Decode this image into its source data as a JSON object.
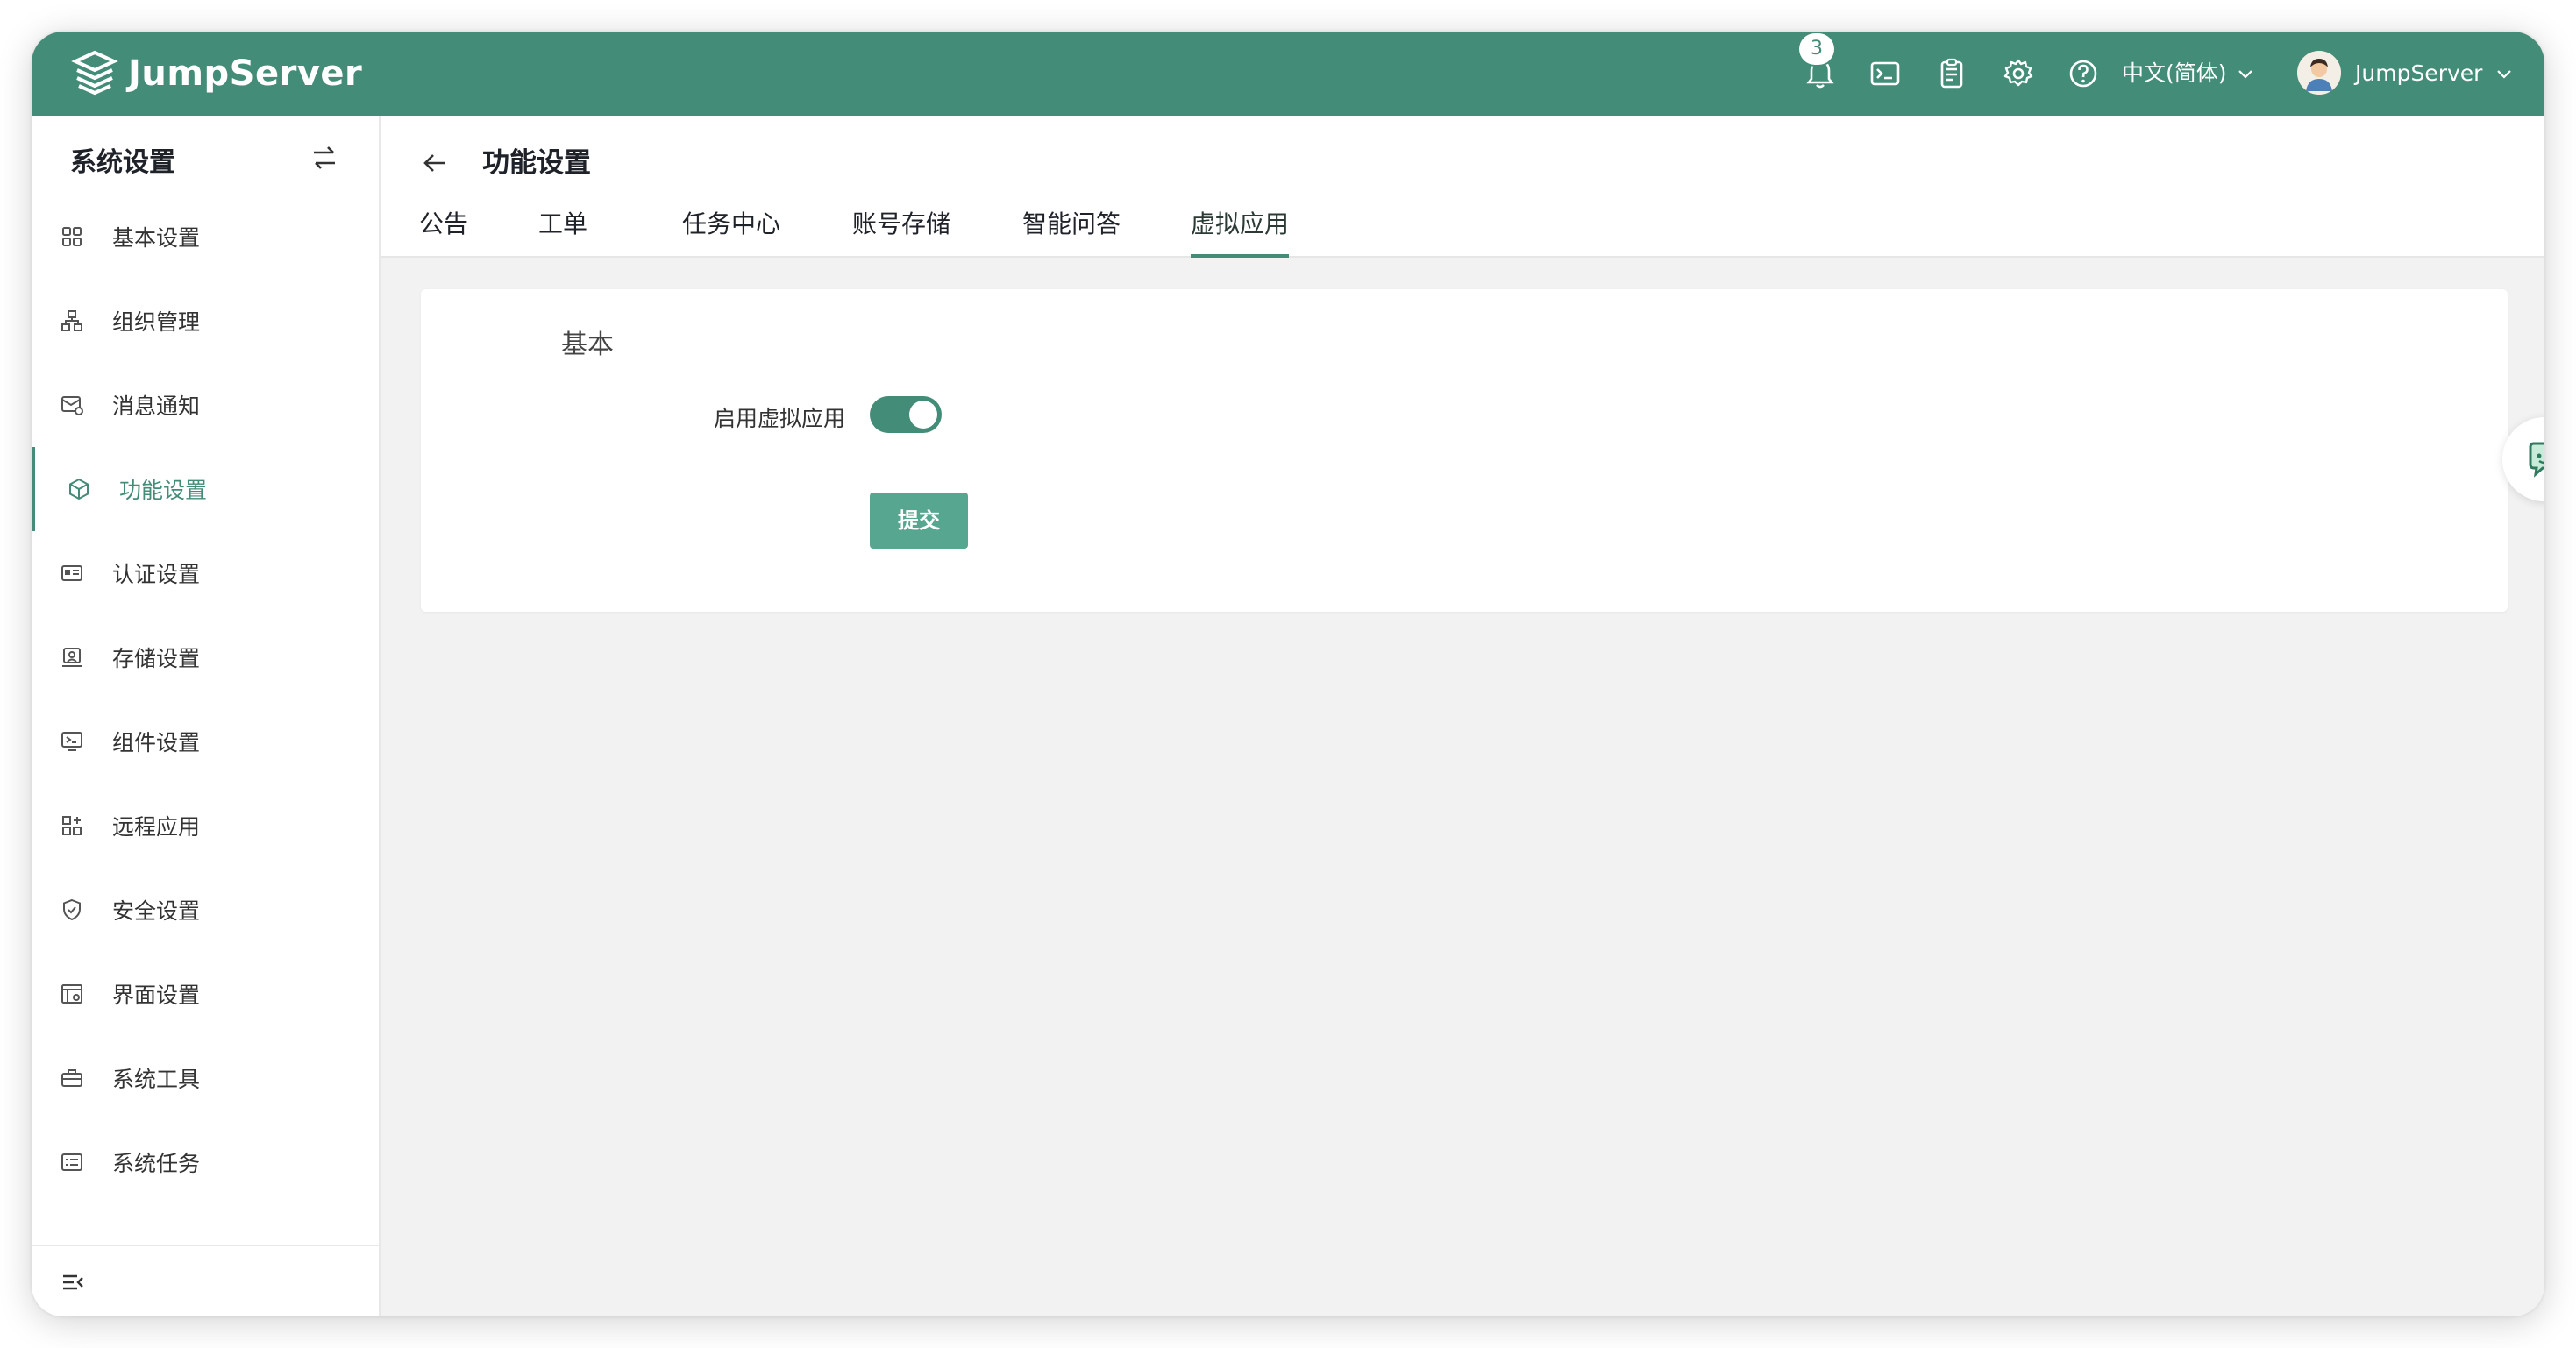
{
  "topbar": {
    "brand": "JumpServer",
    "notification_count": "3",
    "language": "中文(简体)",
    "username": "JumpServer",
    "icons": [
      "bell-icon",
      "terminal-icon",
      "clipboard-icon",
      "gear-icon",
      "help-icon"
    ]
  },
  "sidebar": {
    "title": "系统设置",
    "items": [
      {
        "label": "基本设置",
        "icon": "grid-icon"
      },
      {
        "label": "组织管理",
        "icon": "org-icon"
      },
      {
        "label": "消息通知",
        "icon": "message-icon"
      },
      {
        "label": "功能设置",
        "icon": "cube-icon",
        "active": true
      },
      {
        "label": "认证设置",
        "icon": "id-card-icon"
      },
      {
        "label": "存储设置",
        "icon": "storage-icon"
      },
      {
        "label": "组件设置",
        "icon": "monitor-icon"
      },
      {
        "label": "远程应用",
        "icon": "apps-icon"
      },
      {
        "label": "安全设置",
        "icon": "shield-icon"
      },
      {
        "label": "界面设置",
        "icon": "layout-icon"
      },
      {
        "label": "系统工具",
        "icon": "toolbox-icon"
      },
      {
        "label": "系统任务",
        "icon": "task-icon"
      }
    ]
  },
  "content": {
    "page_title": "功能设置",
    "tabs": [
      "公告",
      "工单",
      "任务中心",
      "账号存储",
      "智能问答",
      "虚拟应用"
    ],
    "active_tab": "虚拟应用",
    "section_title": "基本",
    "field_label": "启用虚拟应用",
    "toggle_on": true,
    "submit_label": "提交"
  },
  "colors": {
    "primary": "#438c77",
    "button": "#57a68f",
    "background": "#f2f2f2"
  }
}
